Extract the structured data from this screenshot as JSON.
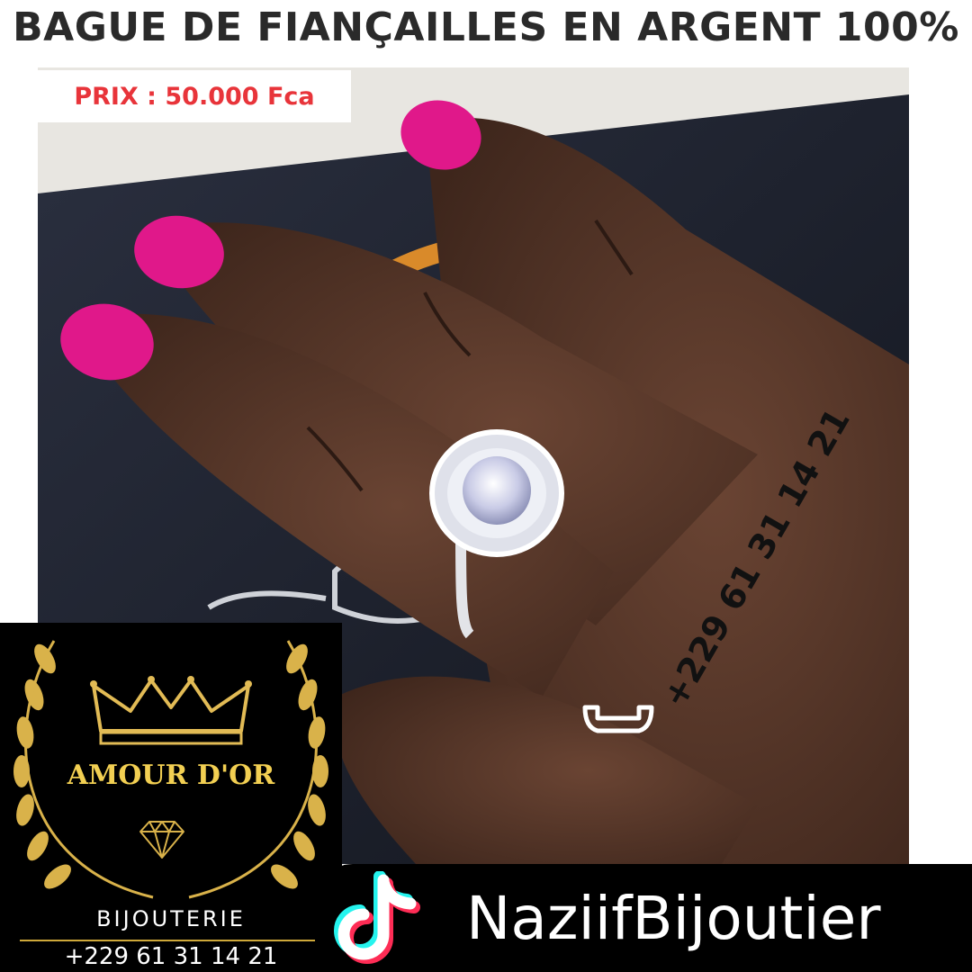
{
  "title": "BAGUE DE FIANÇAILLES EN ARGENT 100%",
  "price": "PRIX : 50.000 Fca",
  "phone_overlay": "+229 61 31 14 21",
  "icons": {
    "phone": "phone-handset-icon",
    "crown": "crown-icon",
    "diamond": "diamond-icon",
    "laurel": "laurel-wreath-icon",
    "tiktok": "tiktok-icon"
  },
  "logo": {
    "name": "AMOUR D'OR",
    "subtitle": "BIJOUTERIE",
    "phone": "+229 61 31 14 21"
  },
  "tiktok": {
    "handle": "NaziifBijoutier"
  },
  "colors": {
    "price_text": "#e8343a",
    "logo_gold": "#f2cf52",
    "nail_polish": "#e0188a",
    "tiktok_cyan": "#25f4ee",
    "tiktok_red": "#fe2c55"
  }
}
